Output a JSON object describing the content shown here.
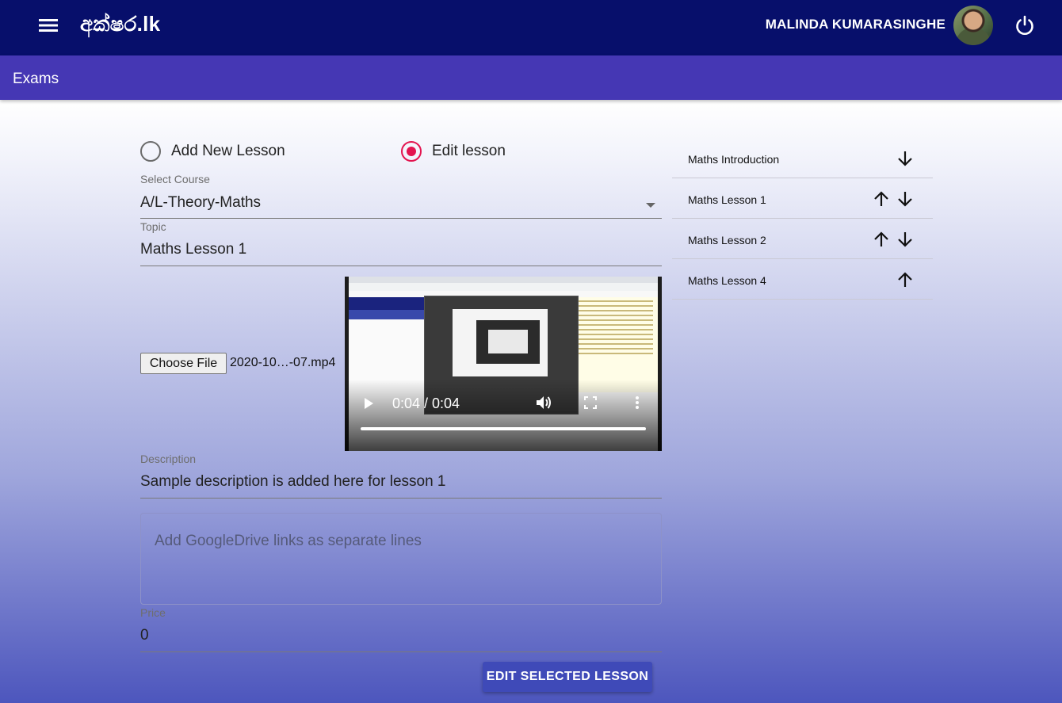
{
  "header": {
    "brand": "අක්ෂර.lk",
    "user_name": "MALINDA KUMARASINGHE"
  },
  "subheader": {
    "title": "Exams"
  },
  "mode": {
    "add_label": "Add New Lesson",
    "edit_label": "Edit lesson",
    "selected": "edit"
  },
  "form": {
    "course_label": "Select Course",
    "course_value": "A/L-Theory-Maths",
    "topic_label": "Topic",
    "topic_value": "Maths Lesson 1",
    "choose_file_label": "Choose File",
    "file_name": "2020-10…-07.mp4",
    "video_time": "0:04 / 0:04",
    "description_label": "Description",
    "description_value": "Sample description is added here for lesson 1",
    "links_placeholder": "Add GoogleDrive links as separate lines",
    "price_label": "Price",
    "price_value": "0",
    "submit_label": "EDIT SELECTED LESSON"
  },
  "lessons": [
    {
      "name": "Maths Introduction",
      "up": false,
      "down": true
    },
    {
      "name": "Maths Lesson 1",
      "up": true,
      "down": true
    },
    {
      "name": "Maths Lesson 2",
      "up": true,
      "down": true
    },
    {
      "name": "Maths Lesson 4",
      "up": true,
      "down": false
    }
  ],
  "colors": {
    "appbar": "#070f6b",
    "subbar": "#4537b4",
    "radio_accent": "#e3144f",
    "button": "#3f4ab8"
  }
}
